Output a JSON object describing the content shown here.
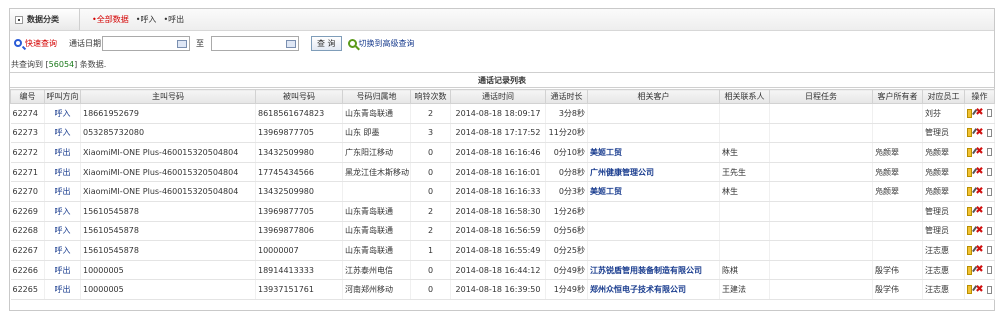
{
  "category": {
    "label": "数据分类"
  },
  "filters": [
    {
      "label": "•全部数据",
      "active": true
    },
    {
      "label": "•呼入",
      "active": false
    },
    {
      "label": "•呼出",
      "active": false
    }
  ],
  "toolbar": {
    "quick_search": "快速查询",
    "date_label": "通话日期",
    "start_date": "",
    "end_date": "",
    "to_label": "至",
    "query_button": "查 询",
    "advanced_link": "切换到高级查询"
  },
  "summary": {
    "prefix": "共查询到 [",
    "count": "56054",
    "suffix": "] 条数据."
  },
  "table": {
    "title": "通话记录列表",
    "columns": [
      "编号",
      "呼叫方向",
      "主叫号码",
      "被叫号码",
      "号码归属地",
      "响铃次数",
      "通话时间",
      "通话时长",
      "相关客户",
      "相关联系人",
      "日程任务",
      "客户所有者",
      "对应员工",
      "操作"
    ],
    "rows": [
      [
        "62274",
        "呼入",
        "18661952679",
        "8618561674823",
        "山东青岛联通",
        "2",
        "2014-08-18 18:09:17",
        "3分8秒",
        "",
        "",
        "",
        "",
        "刘芬"
      ],
      [
        "62273",
        "呼入",
        "053285732080",
        "13969877705",
        "山东 即墨",
        "3",
        "2014-08-18 17:17:52",
        "11分20秒",
        "",
        "",
        "",
        "",
        "管理员"
      ],
      [
        "62272",
        "呼出",
        "XiaomiMI-ONE Plus-460015320504804",
        "13432509980",
        "广东阳江移动",
        "0",
        "2014-08-18 16:16:46",
        "0分10秒",
        "美姬工贸",
        "林生",
        "",
        "凫颜翠",
        "凫颜翠"
      ],
      [
        "62271",
        "呼出",
        "XiaomiMI-ONE Plus-460015320504804",
        "17745434566",
        "黑龙江佳木斯移动",
        "0",
        "2014-08-18 16:16:01",
        "0分8秒",
        "广州健康管理公司",
        "王先生",
        "",
        "凫颜翠",
        "凫颜翠"
      ],
      [
        "62270",
        "呼出",
        "XiaomiMI-ONE Plus-460015320504804",
        "13432509980",
        "",
        "0",
        "2014-08-18 16:16:33",
        "0分3秒",
        "美姬工贸",
        "林生",
        "",
        "凫颜翠",
        "凫颜翠"
      ],
      [
        "62269",
        "呼入",
        "15610545878",
        "13969877705",
        "山东青岛联通",
        "2",
        "2014-08-18 16:58:30",
        "1分26秒",
        "",
        "",
        "",
        "",
        "管理员"
      ],
      [
        "62268",
        "呼入",
        "15610545878",
        "13969877806",
        "山东青岛联通",
        "2",
        "2014-08-18 16:56:59",
        "0分56秒",
        "",
        "",
        "",
        "",
        "管理员"
      ],
      [
        "62267",
        "呼入",
        "15610545878",
        "10000007",
        "山东青岛联通",
        "1",
        "2014-08-18 16:55:49",
        "0分25秒",
        "",
        "",
        "",
        "",
        "汪志惠"
      ],
      [
        "62266",
        "呼出",
        "10000005",
        "18914413333",
        "江苏泰州电信",
        "0",
        "2014-08-18 16:44:12",
        "0分49秒",
        "江苏锐盾管用装备制造有限公司",
        "陈棋",
        "",
        "殷学伟",
        "汪志惠"
      ],
      [
        "62265",
        "呼出",
        "10000005",
        "13937151761",
        "河南郑州移动",
        "0",
        "2014-08-18 16:39:50",
        "1分49秒",
        "郑州众恒电子技术有限公司",
        "王建法",
        "",
        "殷学伟",
        "汪志惠"
      ]
    ]
  }
}
